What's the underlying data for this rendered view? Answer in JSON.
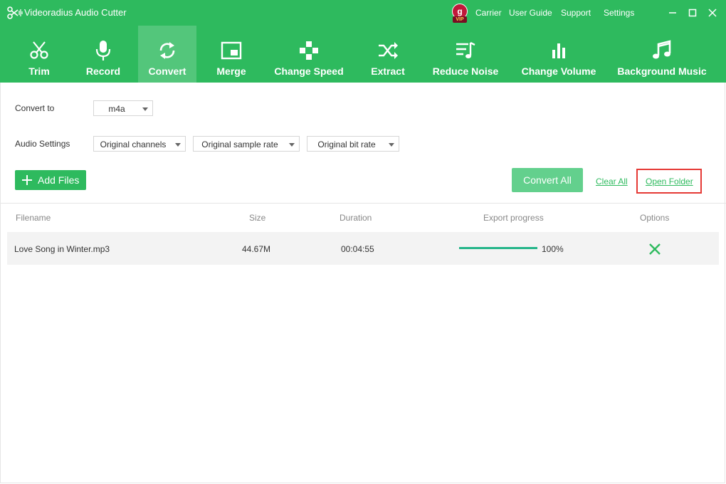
{
  "app": {
    "title": "Videoradius Audio Cutter",
    "accent": "#2eba5e"
  },
  "vip": {
    "initial": "g",
    "tag": "VIP"
  },
  "top_links": {
    "carrier": "Carrier",
    "user_guide": "User Guide",
    "support": "Support",
    "settings": "Settings"
  },
  "window_controls": {
    "minimize_icon": "minimize-icon",
    "maximize_icon": "maximize-icon",
    "close_icon": "close-icon"
  },
  "tabs": [
    {
      "label": "Trim",
      "icon": "scissors-icon"
    },
    {
      "label": "Record",
      "icon": "microphone-icon"
    },
    {
      "label": "Convert",
      "icon": "convert-arrows-icon",
      "active": true
    },
    {
      "label": "Merge",
      "icon": "merge-icon"
    },
    {
      "label": "Change Speed",
      "icon": "gamepad-icon"
    },
    {
      "label": "Extract",
      "icon": "shuffle-icon"
    },
    {
      "label": "Reduce Noise",
      "icon": "noise-list-icon"
    },
    {
      "label": "Change Volume",
      "icon": "volume-bars-icon"
    },
    {
      "label": "Background Music",
      "icon": "music-note-icon"
    }
  ],
  "convert_to": {
    "label": "Convert to",
    "value": "m4a"
  },
  "audio_settings": {
    "label": "Audio Settings",
    "channels": "Original channels",
    "sample_rate": "Original sample rate",
    "bit_rate": "Original bit rate"
  },
  "actions": {
    "add_files": "Add Files",
    "convert_all": "Convert All",
    "clear_all": "Clear All",
    "open_folder": "Open Folder"
  },
  "table": {
    "headers": {
      "filename": "Filename",
      "size": "Size",
      "duration": "Duration",
      "progress": "Export progress",
      "options": "Options"
    },
    "rows": [
      {
        "filename": "Love Song in Winter.mp3",
        "size": "44.67M",
        "duration": "00:04:55",
        "progress": "100%",
        "progress_value": 1.0
      }
    ]
  }
}
